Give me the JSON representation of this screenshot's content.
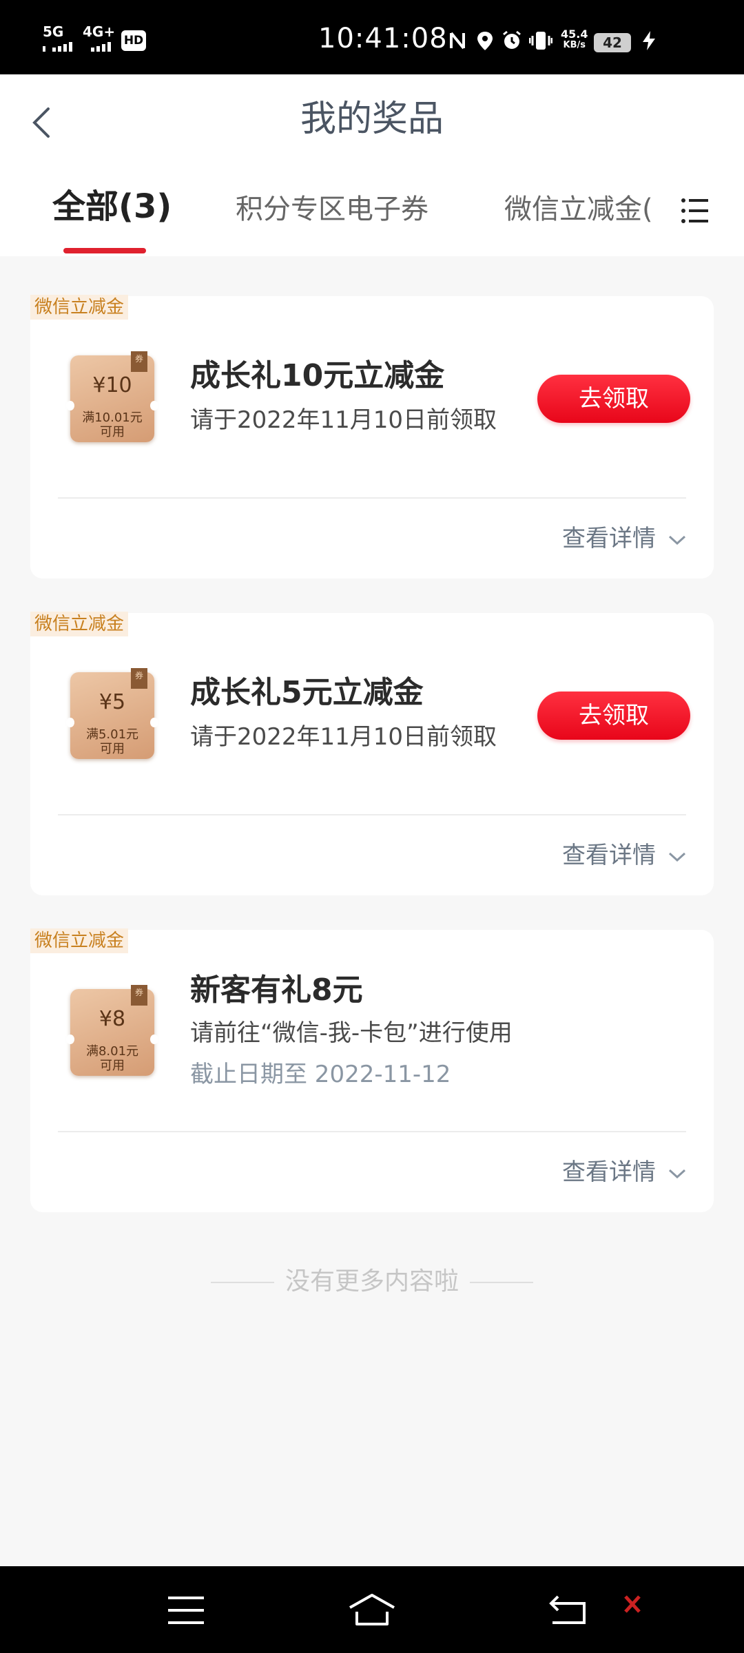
{
  "status_bar": {
    "signal_1": "5G",
    "signal_2": "4G+",
    "hd": "HD",
    "time": "10:41:08",
    "net_speed": "45.4",
    "net_unit": "KB/s",
    "battery": "42"
  },
  "header": {
    "title": "我的奖品",
    "tabs": [
      {
        "label": "全部(3)",
        "active": true
      },
      {
        "label": "积分专区电子券",
        "active": false
      },
      {
        "label": "微信立减金(",
        "active": false
      }
    ]
  },
  "prizes": [
    {
      "tag": "微信立减金",
      "coupon_amount": "¥10",
      "coupon_condition_1": "满10.01元",
      "coupon_condition_2": "可用",
      "coupon_ribbon": "券",
      "title": "成长礼10元立减金",
      "subtitle": "请于2022年11月10日前领取",
      "button": "去领取",
      "detail": "查看详情"
    },
    {
      "tag": "微信立减金",
      "coupon_amount": "¥5",
      "coupon_condition_1": "满5.01元",
      "coupon_condition_2": "可用",
      "coupon_ribbon": "券",
      "title": "成长礼5元立减金",
      "subtitle": "请于2022年11月10日前领取",
      "button": "去领取",
      "detail": "查看详情"
    },
    {
      "tag": "微信立减金",
      "coupon_amount": "¥8",
      "coupon_condition_1": "满8.01元",
      "coupon_condition_2": "可用",
      "coupon_ribbon": "券",
      "title": "新客有礼8元",
      "subtitle": "请前往“微信-我-卡包”进行使用",
      "expiry": "截止日期至 2022-11-12",
      "detail": "查看详情"
    }
  ],
  "footer_text": "没有更多内容啦",
  "colors": {
    "accent_red": "#e8061a",
    "tag_text": "#c8801f",
    "tag_bg": "#fbeee0",
    "coupon_bg": "#d59c74"
  },
  "icons": [
    "back-arrow-icon",
    "list-menu-icon",
    "nfc-icon",
    "location-icon",
    "alarm-icon",
    "vibrate-icon",
    "charging-icon",
    "nav-menu-icon",
    "nav-home-icon",
    "nav-back-icon"
  ]
}
